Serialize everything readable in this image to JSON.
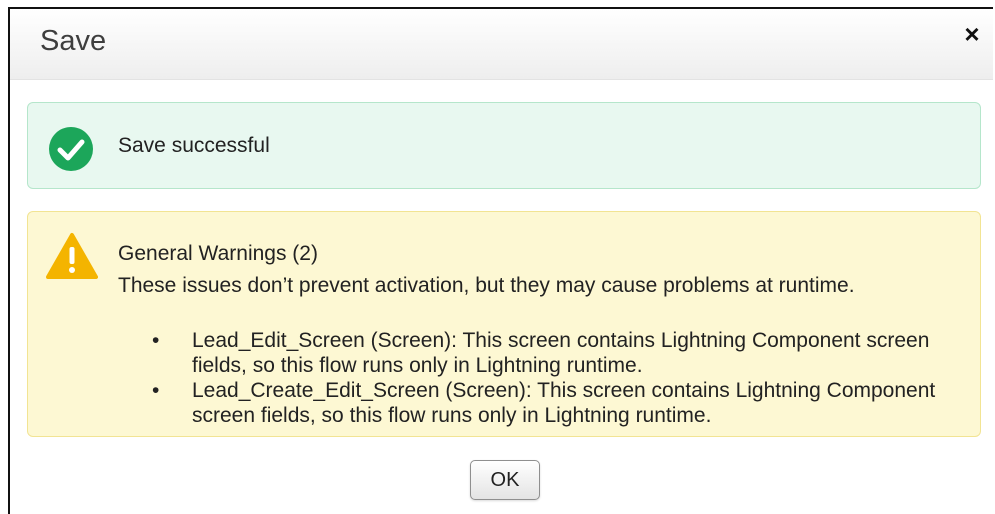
{
  "dialog": {
    "title": "Save",
    "close_glyph": "×"
  },
  "success": {
    "icon": "check-circle-icon",
    "message": "Save successful",
    "color": "#1ca65a"
  },
  "warning": {
    "icon": "warning-triangle-icon",
    "heading": "General Warnings (2)",
    "description": "These issues don’t prevent activation, but they may cause problems at runtime.",
    "color": "#f4b400",
    "items": [
      {
        "text": "Lead_Edit_Screen (Screen): This screen contains Lightning Component screen fields, so this flow runs only in Lightning runtime."
      },
      {
        "text": "Lead_Create_Edit_Screen (Screen): This screen contains Lightning Component screen fields, so this flow runs only in Lightning runtime."
      }
    ]
  },
  "footer": {
    "ok_label": "OK"
  }
}
